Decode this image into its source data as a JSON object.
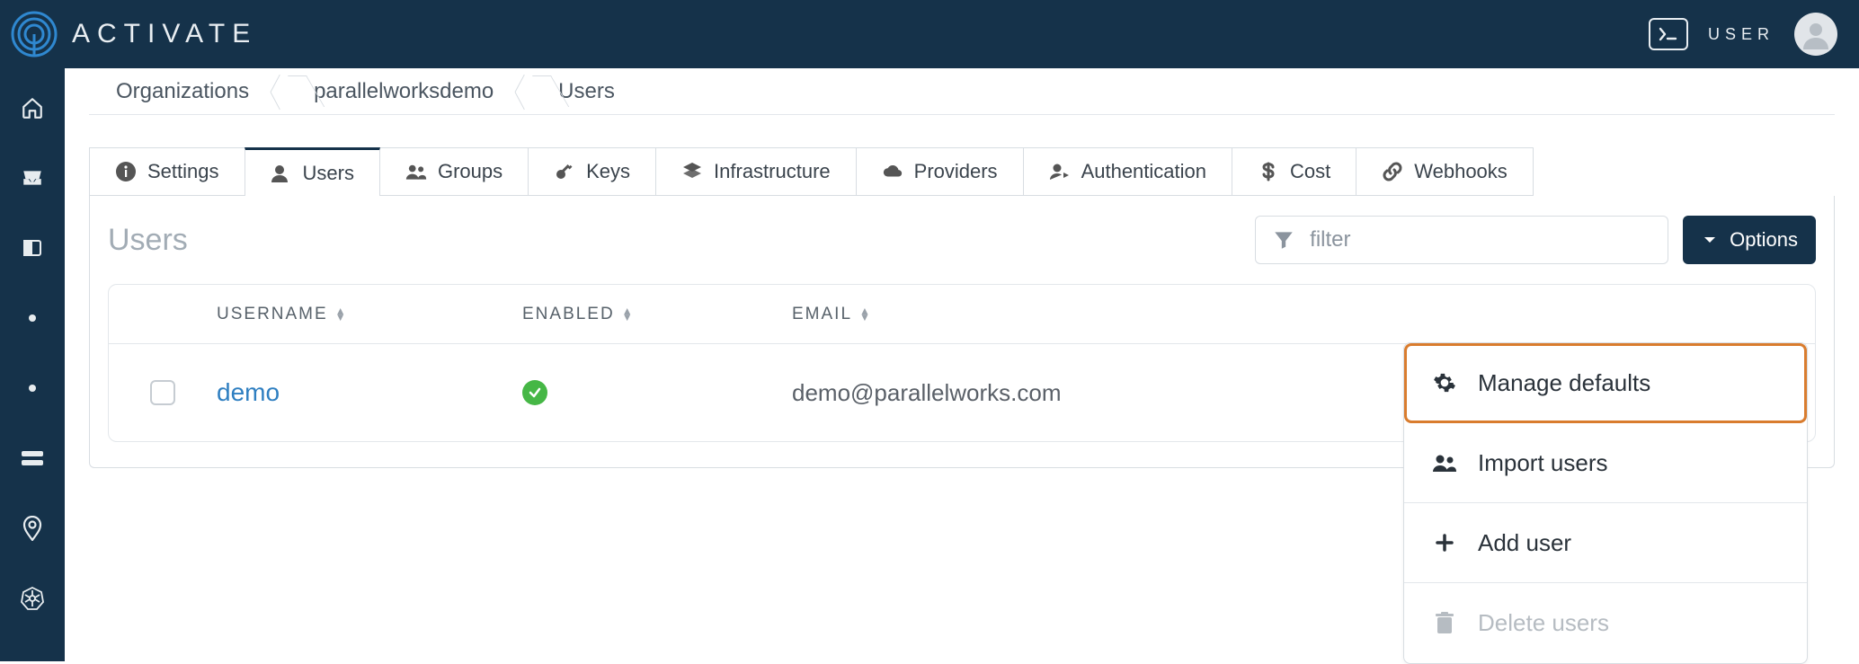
{
  "brand": {
    "name": "ACTIVATE"
  },
  "navbar": {
    "user_label": "USER"
  },
  "breadcrumbs": [
    "Organizations",
    "parallelworksdemo",
    "Users"
  ],
  "tabs": [
    {
      "id": "settings",
      "label": "Settings",
      "icon": "info"
    },
    {
      "id": "users",
      "label": "Users",
      "icon": "user",
      "active": true
    },
    {
      "id": "groups",
      "label": "Groups",
      "icon": "users"
    },
    {
      "id": "keys",
      "label": "Keys",
      "icon": "key"
    },
    {
      "id": "infrastructure",
      "label": "Infrastructure",
      "icon": "layers"
    },
    {
      "id": "providers",
      "label": "Providers",
      "icon": "cloud"
    },
    {
      "id": "authentication",
      "label": "Authentication",
      "icon": "auth"
    },
    {
      "id": "cost",
      "label": "Cost",
      "icon": "dollar"
    },
    {
      "id": "webhooks",
      "label": "Webhooks",
      "icon": "link"
    }
  ],
  "panel": {
    "title": "Users",
    "filter_placeholder": "filter",
    "options_label": "Options"
  },
  "table": {
    "columns": {
      "username": "USERNAME",
      "enabled": "ENABLED",
      "email": "EMAIL"
    },
    "rows": [
      {
        "username": "demo",
        "enabled": true,
        "email": "demo@parallelworks.com"
      }
    ]
  },
  "options_menu": [
    {
      "id": "manage-defaults",
      "label": "Manage defaults",
      "icon": "gear",
      "highlight": true
    },
    {
      "id": "import-users",
      "label": "Import users",
      "icon": "users"
    },
    {
      "id": "add-user",
      "label": "Add user",
      "icon": "plus"
    },
    {
      "id": "delete-users",
      "label": "Delete users",
      "icon": "trash",
      "disabled": true
    }
  ]
}
